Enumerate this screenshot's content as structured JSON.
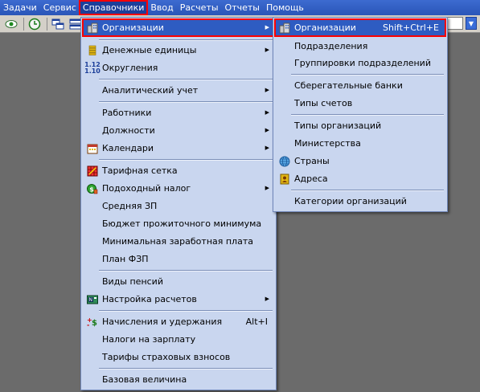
{
  "menubar": {
    "items": [
      {
        "label": "Задачи"
      },
      {
        "label": "Сервис"
      },
      {
        "label": "Справочники"
      },
      {
        "label": "Ввод"
      },
      {
        "label": "Расчеты"
      },
      {
        "label": "Отчеты"
      },
      {
        "label": "Помощь"
      }
    ]
  },
  "main_menu": {
    "items": {
      "organizations": "Организации",
      "currencies": "Денежные единицы",
      "rounding": "Округления",
      "analytic": "Аналитический учет",
      "employees": "Работники",
      "positions": "Должности",
      "calendars": "Календари",
      "tariff": "Тарифная сетка",
      "income_tax": "Подоходный налог",
      "avg_salary": "Средняя ЗП",
      "living_wage": "Бюджет прожиточного минимума",
      "min_wage": "Минимальная заработная плата",
      "plan": "План ФЗП",
      "pensions": "Виды пенсий",
      "calc_settings": "Настройка расчетов",
      "accruals": "Начисления и удержания",
      "accruals_shortcut": "Alt+I",
      "payroll_taxes": "Налоги на зарплату",
      "insurance": "Тарифы страховых взносов",
      "base_value": "Базовая величина"
    }
  },
  "sub_menu": {
    "items": {
      "organizations": "Организации",
      "organizations_shortcut": "Shift+Ctrl+E",
      "divisions": "Подразделения",
      "division_groups": "Группировки подразделений",
      "savings_banks": "Сберегательные банки",
      "account_types": "Типы счетов",
      "org_types": "Типы организаций",
      "ministries": "Министерства",
      "countries": "Страны",
      "addresses": "Адреса",
      "org_categories": "Категории организаций"
    }
  },
  "colors": {
    "menu_bg": "#c9d6ef",
    "highlight": "#2e5cc2",
    "menubar": "#2a55b8",
    "annotation": "#ff0000"
  }
}
